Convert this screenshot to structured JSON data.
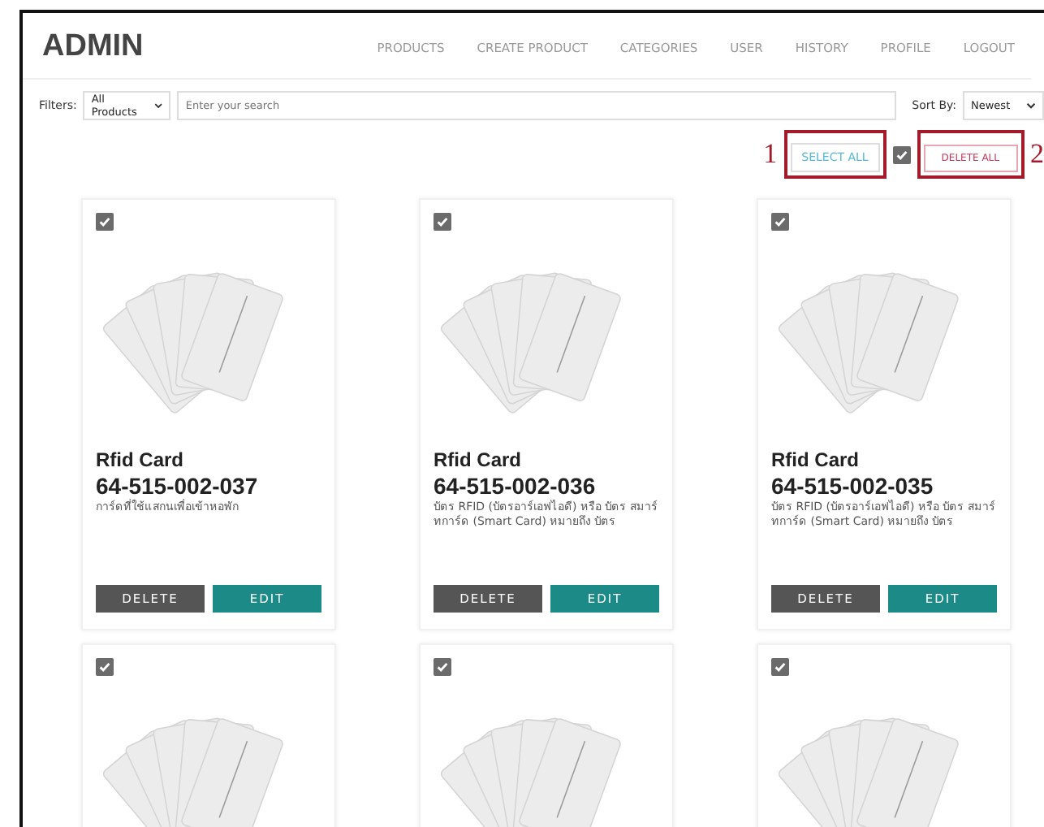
{
  "brand": "ADMIN",
  "nav": [
    {
      "label": "PRODUCTS"
    },
    {
      "label": "CREATE PRODUCT"
    },
    {
      "label": "CATEGORIES"
    },
    {
      "label": "USER"
    },
    {
      "label": "HISTORY"
    },
    {
      "label": "PROFILE"
    },
    {
      "label": "LOGOUT"
    }
  ],
  "filters": {
    "label": "Filters:",
    "category": "All Products",
    "search_placeholder": "Enter your search",
    "sort_label": "Sort By:",
    "sort": "Newest"
  },
  "bulk": {
    "select_all": "SELECT ALL",
    "all_checked": true,
    "delete_all": "DELETE ALL",
    "callouts": [
      "1",
      "2"
    ]
  },
  "products": [
    {
      "checked": true,
      "name": "Rfid Card",
      "code": "64-515-002-037",
      "description": "การ์ดที่ใช้แสกนเพื่อเข้าหอพัก",
      "buttons": [
        "DELETE",
        "EDIT"
      ]
    },
    {
      "checked": true,
      "name": "Rfid Card",
      "code": "64-515-002-036",
      "description": "บัตร RFID (บัตรอาร์เอฟไอดี) หรือ บัตร สมาร์ทการ์ด (Smart Card) หมายถึง บัตร",
      "buttons": [
        "DELETE",
        "EDIT"
      ]
    },
    {
      "checked": true,
      "name": "Rfid Card",
      "code": "64-515-002-035",
      "description": "บัตร RFID (บัตรอาร์เอฟไอดี) หรือ บัตร สมาร์ทการ์ด (Smart Card) หมายถึง บัตร",
      "buttons": [
        "DELETE",
        "EDIT"
      ]
    },
    {
      "checked": true
    },
    {
      "checked": true
    },
    {
      "checked": true
    }
  ]
}
